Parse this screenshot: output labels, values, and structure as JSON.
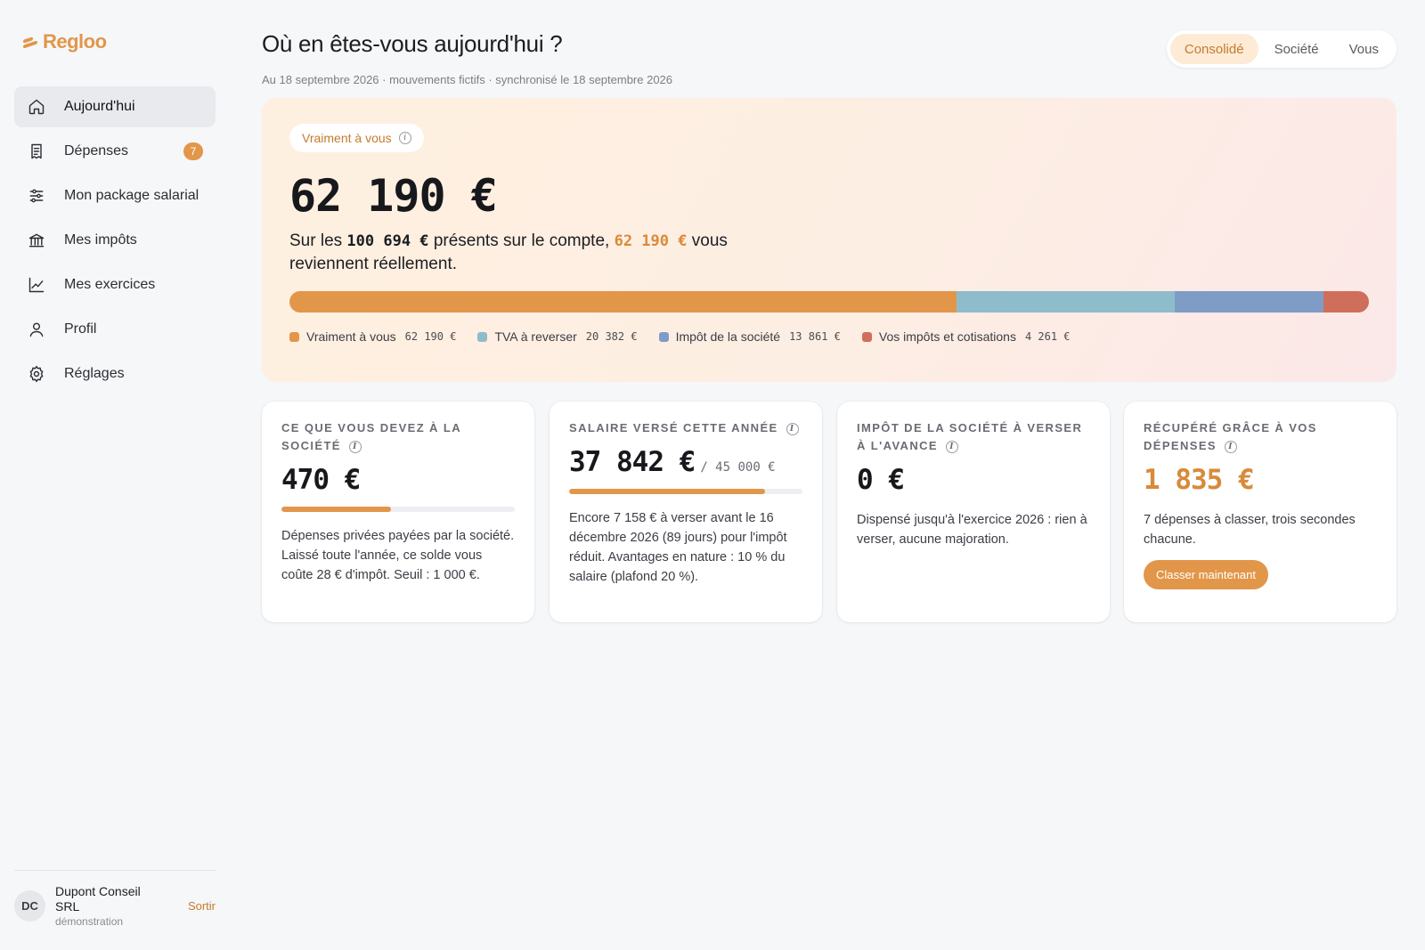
{
  "app": {
    "name": "Regloo"
  },
  "sidebar": {
    "items": [
      {
        "label": "Aujourd'hui",
        "icon": "home-icon",
        "active": true
      },
      {
        "label": "Dépenses",
        "icon": "receipt-icon",
        "badge": "7"
      },
      {
        "label": "Mon package salarial",
        "icon": "sliders-icon"
      },
      {
        "label": "Mes impôts",
        "icon": "bank-icon"
      },
      {
        "label": "Mes exercices",
        "icon": "chart-line-icon"
      },
      {
        "label": "Profil",
        "icon": "user-icon"
      },
      {
        "label": "Réglages",
        "icon": "gear-icon"
      }
    ],
    "user": {
      "initials": "DC",
      "name": "Dupont Conseil SRL",
      "role": "démonstration",
      "logout_label": "Sortir"
    }
  },
  "header": {
    "title": "Où en êtes-vous aujourd'hui ?",
    "subtitle": "Au 18 septembre 2026 · mouvements fictifs · synchronisé le 18 septembre 2026",
    "segments": [
      "Consolidé",
      "Société",
      "Vous"
    ],
    "active_segment": "Consolidé"
  },
  "hero": {
    "tag": "Vraiment à vous",
    "amount": "62 190 €",
    "text_prefix": "Sur les ",
    "text_total": "100 694 €",
    "text_middle": " présents sur le compte, ",
    "text_highlight": "62 190 €",
    "text_suffix": " vous reviennent réellement.",
    "breakdown": [
      {
        "label": "Vraiment à vous",
        "value_label": "62 190 €",
        "value": 62190,
        "color": "#e2964a"
      },
      {
        "label": "TVA à reverser",
        "value_label": "20 382 €",
        "value": 20382,
        "color": "#8fbcca"
      },
      {
        "label": "Impôt de la société",
        "value_label": "13 861 €",
        "value": 13861,
        "color": "#7f9cc6"
      },
      {
        "label": "Vos impôts et cotisations",
        "value_label": "4 261 €",
        "value": 4261,
        "color": "#d06e5c"
      }
    ]
  },
  "cards": [
    {
      "label": "Ce que vous devez à la société",
      "value": "470 €",
      "progress": 0.47,
      "description": "Dépenses privées payées par la société. Laissé toute l'année, ce solde vous coûte 28 € d'impôt. Seuil : 1 000 €."
    },
    {
      "label": "Salaire versé cette année",
      "value": "37 842 €",
      "value_of": "/ 45 000 €",
      "progress": 0.841,
      "description": "Encore 7 158 € à verser avant le 16 décembre 2026 (89 jours) pour l'impôt réduit. Avantages en nature : 10 % du salaire (plafond 20 %)."
    },
    {
      "label": "Impôt de la société à verser à l'avance",
      "value": "0 €",
      "description": "Dispensé jusqu'à l'exercice 2026 : rien à verser, aucune majoration."
    },
    {
      "label": "Récupéré grâce à vos dépenses",
      "value": "1 835 €",
      "description": "7 dépenses à classer, trois secondes chacune.",
      "cta": "Classer maintenant"
    }
  ],
  "colors": {
    "accent": "#e2964a",
    "accent_text": "#c67a2c"
  }
}
